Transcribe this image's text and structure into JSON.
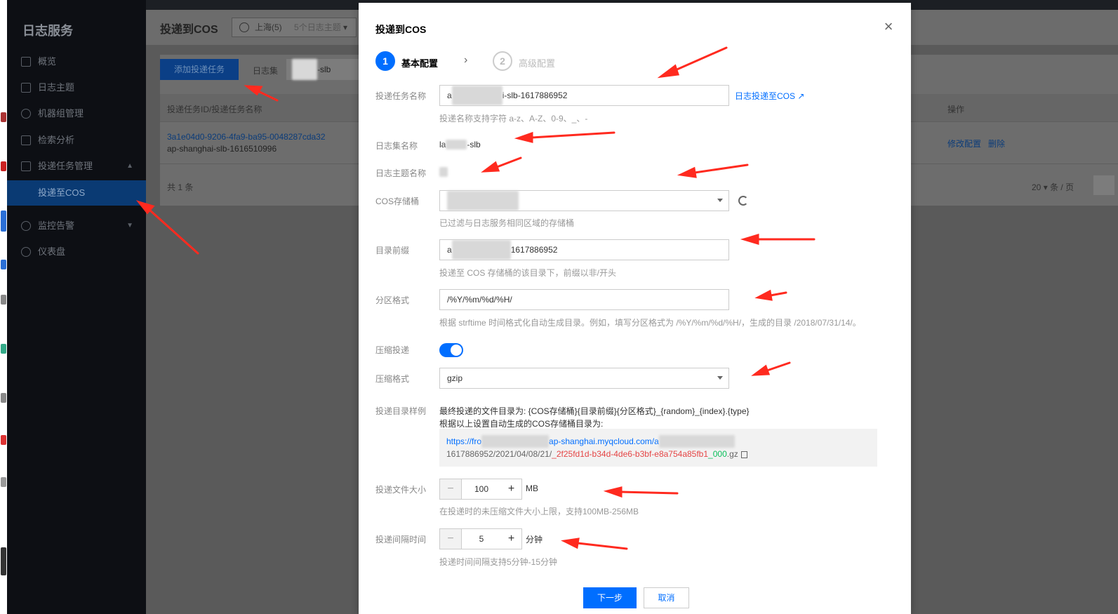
{
  "sidebar": {
    "brand": "日志服务",
    "items": [
      {
        "label": "概览",
        "icon": "grid-icon"
      },
      {
        "label": "日志主题",
        "icon": "document-icon"
      },
      {
        "label": "机器组管理",
        "icon": "gear-icon"
      },
      {
        "label": "检索分析",
        "icon": "search-icon"
      },
      {
        "label": "投递任务管理",
        "icon": "box-icon"
      },
      {
        "label": "投递至COS",
        "icon": ""
      },
      {
        "label": "监控告警",
        "icon": "monitor-icon"
      },
      {
        "label": "仪表盘",
        "icon": "dashboard-icon"
      }
    ]
  },
  "main": {
    "title": "投递到COS",
    "region": "上海(5)",
    "topics_count": "5个日志主题",
    "add_button": "添加投递任务",
    "logset_label": "日志集",
    "logset_value": "-slb",
    "table": {
      "col_name": "投递任务ID/投递任务名称",
      "col_ops": "操作",
      "rows": [
        {
          "id": "3a1e04d0-9206-4fa9-ba95-0048287cda32",
          "name": "ap-shanghai-slb-1616510996",
          "op_edit": "修改配置",
          "op_delete": "删除"
        }
      ],
      "total": "共 1 条",
      "page_size": "20",
      "page_unit": "条 / 页"
    }
  },
  "modal": {
    "title": "投递到COS",
    "steps": [
      {
        "num": "1",
        "label": "基本配置"
      },
      {
        "num": "2",
        "label": "高级配置"
      }
    ],
    "task_name": {
      "label": "投递任务名称",
      "value_prefix": "a",
      "value_suffix": "i-slb-1617886952",
      "hint": "投递名称支持字符 a-z、A-Z、0-9、_、-",
      "doc_link": "日志投递至COS"
    },
    "logset": {
      "label": "日志集名称",
      "value_prefix": "la",
      "value_suffix": "-slb"
    },
    "topic": {
      "label": "日志主题名称"
    },
    "bucket": {
      "label": "COS存储桶",
      "hint": "已过滤与日志服务相同区域的存储桶"
    },
    "prefix": {
      "label": "目录前缀",
      "value_prefix": "a",
      "value_suffix": "1617886952",
      "hint": "投递至 COS 存储桶的该目录下，前缀以非/开头"
    },
    "partition": {
      "label": "分区格式",
      "value": "/%Y/%m/%d/%H/",
      "hint": "根据 strftime 时间格式化自动生成目录。例如，填写分区格式为 /%Y/%m/%d/%H/，生成的目录 /2018/07/31/14/。"
    },
    "compress_toggle": {
      "label": "压缩投递",
      "enabled": true
    },
    "compress_format": {
      "label": "压缩格式",
      "value": "gzip"
    },
    "sample": {
      "label": "投递目录样例",
      "line1": "最终投递的文件目录为: {COS存储桶}{目录前缀}{分区格式}_{random}_{index}.{type}",
      "line2": "根据以上设置自动生成的COS存储桶目录为:",
      "url_start": "https://fro",
      "url_region": "ap-shanghai.myqcloud.com/a",
      "url_id": "1617886952",
      "url_date": "/2021/04/08/21/",
      "url_random": "_2f25fd1d-b34d-4de6-b3bf-e8a754a85fb1",
      "url_index": "_000",
      "url_ext": ".gz"
    },
    "file_size": {
      "label": "投递文件大小",
      "value": "100",
      "unit": "MB",
      "hint": "在投递时的未压缩文件大小上限，支持100MB-256MB"
    },
    "interval": {
      "label": "投递间隔时间",
      "value": "5",
      "unit": "分钟",
      "hint": "投递时间间隔支持5分钟-15分钟"
    },
    "minus": "−",
    "plus": "+",
    "next_button": "下一步",
    "cancel_button": "取消",
    "close": "×",
    "step_arrow": "›"
  },
  "colors": {
    "primary": "#006eff",
    "annotation": "#ff2a1f"
  }
}
